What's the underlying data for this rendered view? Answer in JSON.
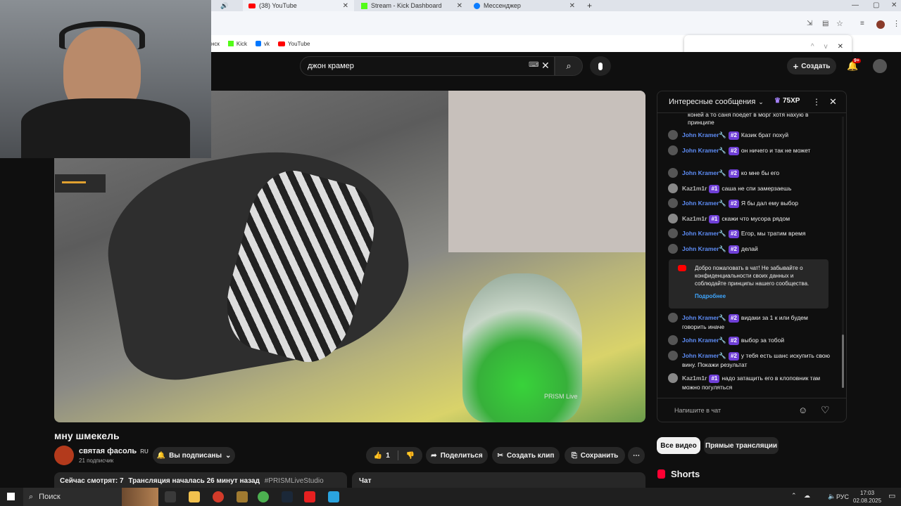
{
  "browser": {
    "tabs": [
      {
        "label": "(38) YouTube",
        "icon": "youtube-icon",
        "color": "#ff0000"
      },
      {
        "label": "Stream - Kick Dashboard",
        "icon": "kick-icon",
        "color": "#53fc18"
      },
      {
        "label": "Мессенджер",
        "icon": "messenger-icon",
        "color": "#0a7cff"
      }
    ],
    "new_tab": "+",
    "bookmarks": [
      {
        "label": "Kick",
        "color": "#53fc18"
      },
      {
        "label": "vk",
        "color": "#0077ff"
      },
      {
        "label": "YouTube",
        "color": "#ff0000"
      }
    ],
    "bookmark_partial": "нск",
    "find_controls": [
      "^",
      "v",
      "✕"
    ]
  },
  "youtube": {
    "search_query": "джон крамер",
    "create_label": "Создать",
    "notif_count": "9+"
  },
  "video": {
    "title": "мну шмекель",
    "watermark": "PRISM Live"
  },
  "channel": {
    "name": "святая фасоль",
    "country": "RU",
    "subscribers": "21 подписчик",
    "subscribed_label": "Вы подписаны"
  },
  "actions": {
    "likes": "1",
    "share": "Поделиться",
    "clip": "Создать клип",
    "save": "Сохранить",
    "more": "⋯"
  },
  "description": {
    "viewers": "Сейчас смотрят: 7",
    "started": "Трансляция началась 26 минут назад",
    "hashtag": "#PRISMLiveStudio"
  },
  "chat_replay_label": "Чат",
  "chat": {
    "header": "Интересные сообщения",
    "xp": "75XP",
    "top_fragment": "коней а то саня поедет в морг хотя нахую в принципе",
    "messages": [
      {
        "name": "John Kramer🔧",
        "badge": "#2",
        "text": "Казик брат похуй"
      },
      {
        "name": "John Kramer🔧",
        "badge": "#2",
        "text": "он ничего и так не может"
      },
      {
        "name": "John Kramer🔧",
        "badge": "#2",
        "text": "ко мне бы его"
      },
      {
        "name": "Kaz1m1r",
        "badge": "#1",
        "text": "саша не спи замерзаешь"
      },
      {
        "name": "John Kramer🔧",
        "badge": "#2",
        "text": "Я бы дал ему выбор"
      },
      {
        "name": "Kaz1m1r",
        "badge": "#1",
        "text": "скажи что мусора рядом"
      },
      {
        "name": "John Kramer🔧",
        "badge": "#2",
        "text": "Егор, мы тратим время"
      },
      {
        "name": "John Kramer🔧",
        "badge": "#2",
        "text": "делай"
      }
    ],
    "welcome_text": "Добро пожаловать в чат! Не забывайте о конфиденциальности своих данных и соблюдайте принципы нашего сообщества.",
    "welcome_link": "Подробнее",
    "messages2": [
      {
        "name": "John Kramer🔧",
        "badge": "#2",
        "text": "видаки за 1 к или будем говорить иначе"
      },
      {
        "name": "John Kramer🔧",
        "badge": "#2",
        "text": "выбор за тобой"
      },
      {
        "name": "John Kramer🔧",
        "badge": "#2",
        "text": "у тебя есть шанс искупить свою вину. Покажи результат"
      },
      {
        "name": "Kaz1m1r",
        "badge": "#1",
        "text": "надо затащить его в клоповник там можно погуляться"
      }
    ],
    "input_placeholder": "Напишите в чат"
  },
  "filters": [
    "Все видео",
    "Прямые трансляции"
  ],
  "shorts_label": "Shorts",
  "taskbar": {
    "search": "Поиск",
    "lang": "РУС",
    "time": "17:03",
    "date": "02.08.2025"
  }
}
